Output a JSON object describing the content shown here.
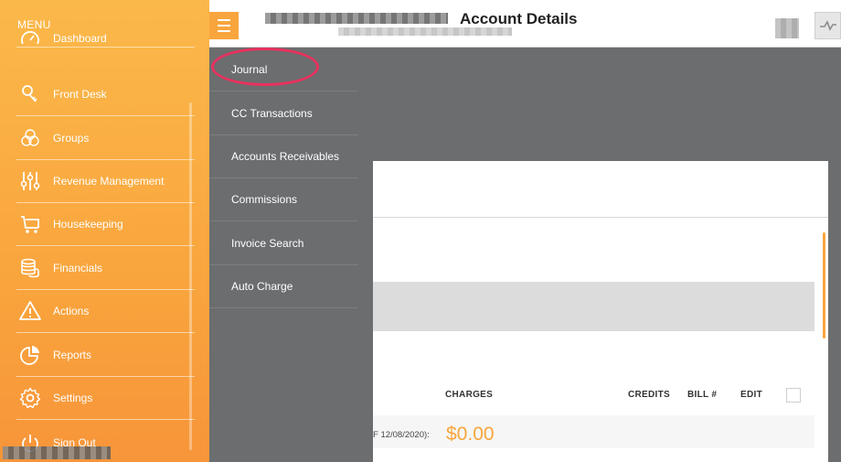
{
  "sidebar": {
    "menu_label": "MENU",
    "items": [
      {
        "label": "Dashboard",
        "icon": "dashboard-icon"
      },
      {
        "label": "Front Desk",
        "icon": "front-desk-icon"
      },
      {
        "label": "Groups",
        "icon": "groups-icon"
      },
      {
        "label": "Revenue Management",
        "icon": "sliders-icon"
      },
      {
        "label": "Housekeeping",
        "icon": "cart-icon"
      },
      {
        "label": "Financials",
        "icon": "coins-icon"
      },
      {
        "label": "Actions",
        "icon": "alert-icon"
      },
      {
        "label": "Reports",
        "icon": "pie-chart-icon"
      },
      {
        "label": "Settings",
        "icon": "gear-icon"
      },
      {
        "label": "Sign Out",
        "icon": "power-icon"
      }
    ]
  },
  "submenu": {
    "items": [
      {
        "label": "Journal"
      },
      {
        "label": "CC Transactions"
      },
      {
        "label": "Accounts Receivables"
      },
      {
        "label": "Commissions"
      },
      {
        "label": "Invoice Search"
      },
      {
        "label": "Auto Charge"
      }
    ]
  },
  "header": {
    "title": "Account Details"
  },
  "table": {
    "headers": {
      "charges": "CHARGES",
      "credits": "CREDITS",
      "bill": "BILL #",
      "edit": "EDIT"
    }
  },
  "balance": {
    "label": "F 12/08/2020):",
    "value": "$0.00"
  },
  "colors": {
    "accent": "#f9a53d",
    "highlight": "#e8315e",
    "overlay": "#6b6d6f"
  }
}
